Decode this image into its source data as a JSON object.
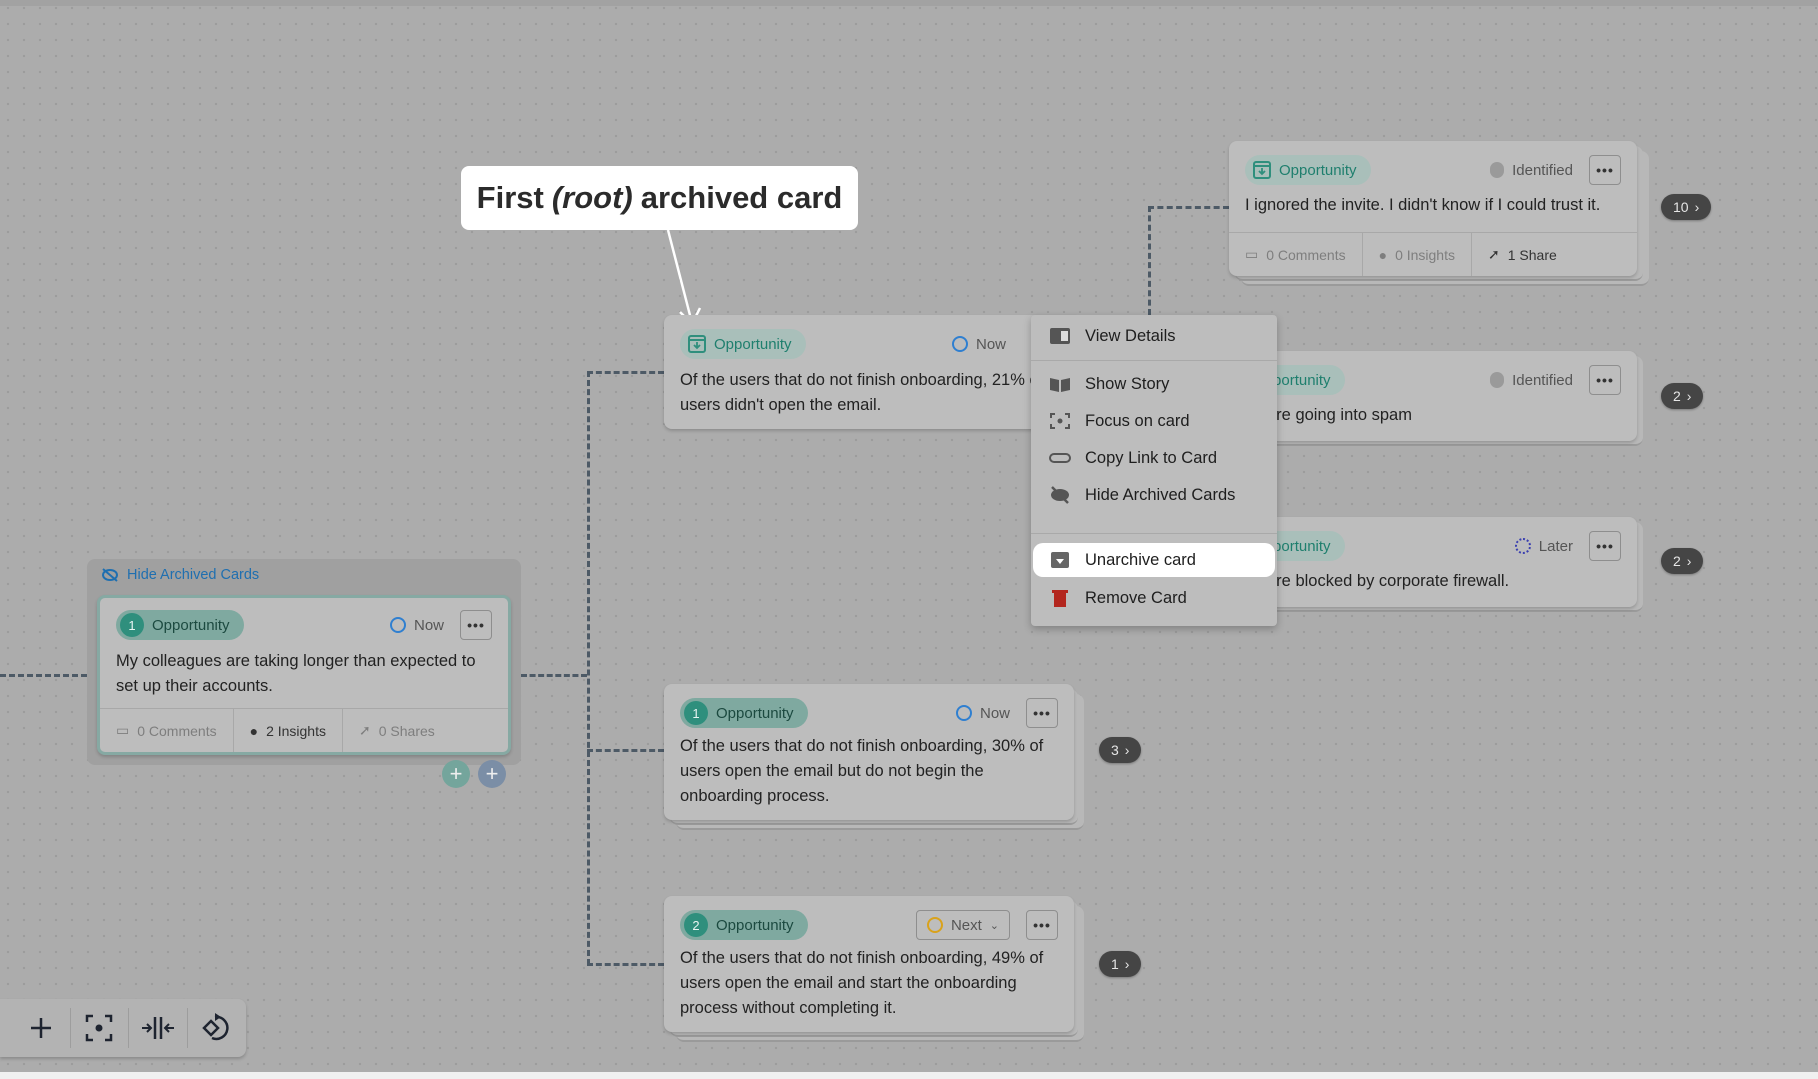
{
  "callout": {
    "before": "First",
    "emph": "(root)",
    "after": "archived card"
  },
  "root_card": {
    "type": "Opportunity",
    "icon": "archive-icon",
    "status": "Now",
    "text": "Of the users that do not finish onboarding, 21% of users didn't open the email."
  },
  "context_menu": {
    "items": [
      {
        "label": "View Details",
        "icon": "sidebar-panel-icon"
      },
      {
        "label": "Show Story",
        "icon": "book-icon"
      },
      {
        "label": "Focus on card",
        "icon": "focus-icon"
      },
      {
        "label": "Copy Link to Card",
        "icon": "link-icon"
      },
      {
        "label": "Hide Archived Cards",
        "icon": "eye-off-icon"
      },
      {
        "label": "Unarchive card",
        "icon": "unarchive-icon",
        "highlighted": true
      },
      {
        "label": "Remove Card",
        "icon": "trash-icon",
        "color": "#b3261e"
      }
    ]
  },
  "right_cards": [
    {
      "type": "Opportunity",
      "status": "Identified",
      "text": "I ignored the invite. I didn't know if I could trust it.",
      "comments": "0 Comments",
      "insights": "0 Insights",
      "shares": "1 Share",
      "count": "10"
    },
    {
      "type": "Opportunity",
      "status": "Identified",
      "text": "es are going into spam",
      "count": "2"
    },
    {
      "type": "Opportunity",
      "status": "Later",
      "text": "es are blocked by corporate firewall.",
      "count": "2"
    }
  ],
  "archived_group": {
    "toggle_label": "Hide Archived Cards",
    "card": {
      "number": "1",
      "type": "Opportunity",
      "status": "Now",
      "text": "My colleagues are taking longer than expected to set up their accounts.",
      "comments": "0 Comments",
      "insights": "2 Insights",
      "shares": "0 Shares"
    }
  },
  "middle_cards": [
    {
      "number": "1",
      "type": "Opportunity",
      "status": "Now",
      "text": "Of the users that do not finish onboarding, 30% of users open the email but do not begin the onboarding process.",
      "count": "3"
    },
    {
      "number": "2",
      "type": "Opportunity",
      "status": "Next",
      "text": "Of the users that do not finish onboarding, 49% of users open the email and start the onboarding process without completing it.",
      "count": "1"
    }
  ],
  "toolbar": [
    "add-icon",
    "focus-icon",
    "collapse-icon",
    "reset-layout-icon"
  ],
  "colors": {
    "accent": "#2f8f7d",
    "now": "#2f7fd0",
    "next": "#d9a21b",
    "later": "#3a3fb0",
    "danger": "#b3261e"
  }
}
